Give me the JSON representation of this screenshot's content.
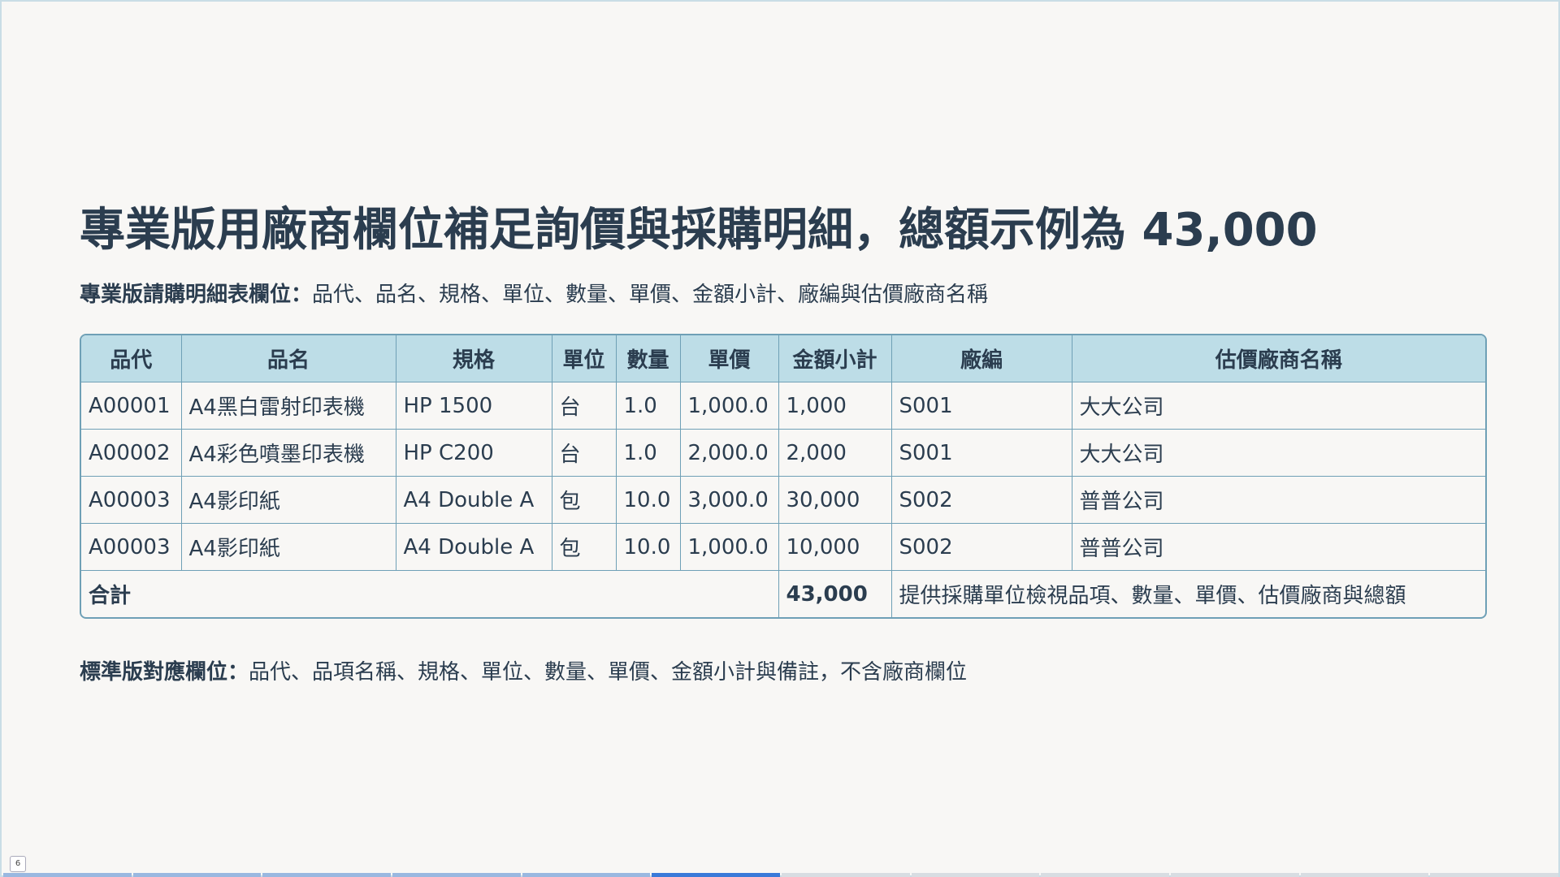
{
  "slide": {
    "title": "專業版用廠商欄位補足詢價與採購明細，總額示例為 43,000",
    "subtitle_bold": "專業版請購明細表欄位：",
    "subtitle_rest": "品代、品名、規格、單位、數量、單價、金額小計、廠編與估價廠商名稱",
    "footnote_bold": "標準版對應欄位：",
    "footnote_rest": "品代、品項名稱、規格、單位、數量、單價、金額小計與備註，不含廠商欄位",
    "page_number": "6"
  },
  "table": {
    "headers": [
      "品代",
      "品名",
      "規格",
      "單位",
      "數量",
      "單價",
      "金額小計",
      "廠編",
      "估價廠商名稱"
    ],
    "rows": [
      [
        "A00001",
        "A4黑白雷射印表機",
        "HP 1500",
        "台",
        "1.0",
        "1,000.0",
        "1,000",
        "S001",
        "大大公司"
      ],
      [
        "A00002",
        "A4彩色噴墨印表機",
        "HP C200",
        "台",
        "1.0",
        "2,000.0",
        "2,000",
        "S001",
        "大大公司"
      ],
      [
        "A00003",
        "A4影印紙",
        "A4 Double A",
        "包",
        "10.0",
        "3,000.0",
        "30,000",
        "S002",
        "普普公司"
      ],
      [
        "A00003",
        "A4影印紙",
        "A4 Double A",
        "包",
        "10.0",
        "1,000.0",
        "10,000",
        "S002",
        "普普公司"
      ]
    ],
    "total": {
      "label": "合計",
      "amount": "43,000",
      "note": "提供採購單位檢視品項、數量、單價、估價廠商與總額"
    }
  },
  "progress": {
    "total_segments": 12,
    "current_segment": 6
  },
  "colors": {
    "header_bg": "#bddde7",
    "border": "#6fa0b6",
    "text": "#2b3d4f",
    "background": "#f8f7f5",
    "progress_active": "#3a7ad9"
  }
}
